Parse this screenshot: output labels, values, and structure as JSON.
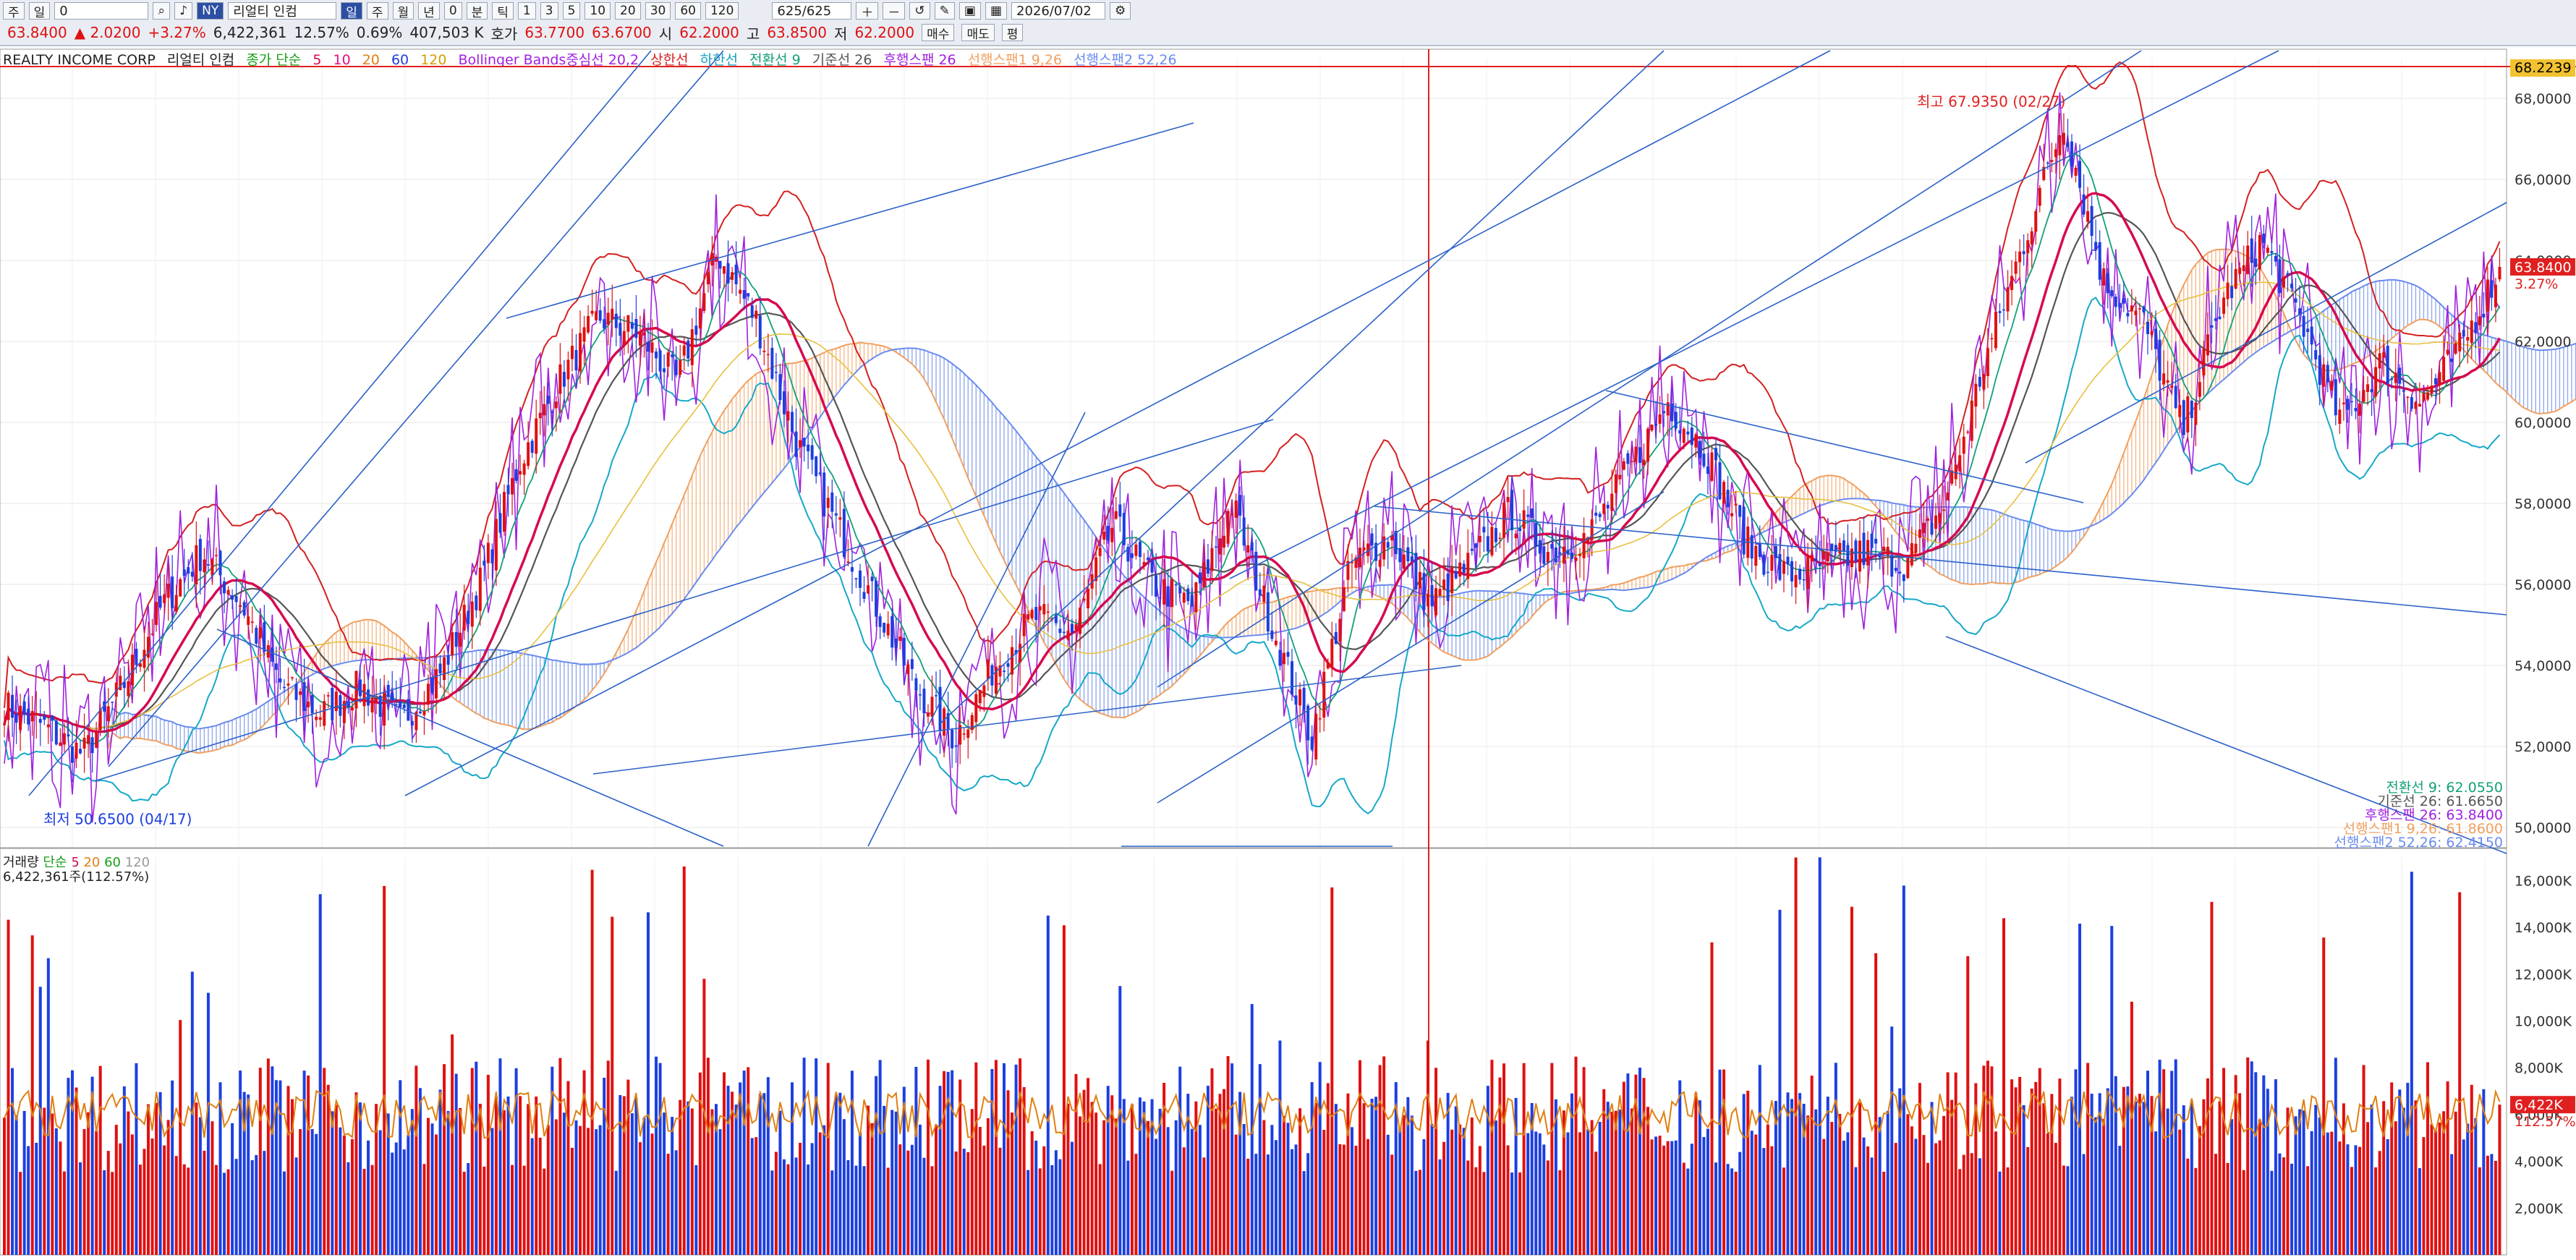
{
  "toolbar": {
    "period_buttons": [
      "주",
      "일",
      "주",
      "월",
      "년",
      "0",
      "분",
      "틱"
    ],
    "code_value": "0",
    "stock_name": "리얼티 인컴",
    "market_badge": "NY",
    "count_value": "625/625",
    "date_value": "2026/07/02",
    "minute_values": [
      "1",
      "3",
      "5",
      "10",
      "20",
      "30",
      "60",
      "120"
    ]
  },
  "quote": {
    "price": "63.8400",
    "change": "▲ 2.0200",
    "change_pct": "+3.27%",
    "volume": "6,422,361",
    "vol_pct": "12.57%",
    "turnover_pct": "0.69%",
    "amount": "407,503 K",
    "ask_label": "호가",
    "ask": "63.7700",
    "bid": "63.6700",
    "open_label": "시",
    "open": "62.2000",
    "high_label": "고",
    "high": "63.8500",
    "low_label": "저",
    "low": "62.2000",
    "buy_label": "매수",
    "sell_label": "매도",
    "eval_label": "평"
  },
  "legend": {
    "title": "REALTY INCOME CORP",
    "name_kr": "리얼티 인컴",
    "ma_label": "종가 단순",
    "ma_periods": [
      "5",
      "10",
      "20",
      "60",
      "120"
    ],
    "bb_label": "Bollinger Bands중심선 20,2",
    "bb_upper": "상한선",
    "bb_lower": "하한선",
    "tenkan": "전환선 9",
    "kijun": "기준선 26",
    "chikou": "후행스팬 26",
    "senkou1": "선행스팬1 9,26",
    "senkou2": "선행스팬2 52,26"
  },
  "annotations": {
    "high_label": "최고 67.9350 (02/27)",
    "low_label": "최저 50.6500 (04/17)"
  },
  "ichimoku_values": [
    "전환선 9: 62.0550",
    "기준선 26: 61.6650",
    "후행스팬 26: 63.8400",
    "선행스팬1 9,26: 61.8600",
    "선행스팬2 52,26: 62.4150"
  ],
  "price_axis": {
    "ticks": [
      "68,0000",
      "66,0000",
      "64,0000",
      "62,0000",
      "60,0000",
      "58,0000",
      "56,0000",
      "54,0000",
      "52,0000",
      "50,0000"
    ],
    "last_price_tag": "63.8400",
    "last_pct_tag": "3.27%",
    "top_tag": "68.2239"
  },
  "volume": {
    "legend_label": "거래량",
    "ma_label": "단순",
    "ma_periods": [
      "5",
      "20",
      "60",
      "120"
    ],
    "current_text": "6,422,361주(112.57%)",
    "axis_ticks": [
      "16,000K",
      "14,000K",
      "12,000K",
      "10,000K",
      "8,000K",
      "6,000K",
      "4,000K",
      "2,000K"
    ],
    "last_tag": "6,422K",
    "last_pct": "112.57%"
  },
  "chart_data": {
    "type": "candlestick",
    "title": "REALTY INCOME CORP",
    "ylim": [
      49.5,
      69.0
    ],
    "price_path": [
      53.0,
      52.5,
      51.8,
      53.5,
      55.5,
      56.8,
      55.5,
      53.5,
      52.8,
      53.5,
      52.6,
      53.8,
      56.0,
      59.0,
      61.0,
      62.6,
      62.2,
      61.0,
      64.2,
      62.5,
      59.5,
      57.5,
      55.5,
      53.5,
      52.2,
      54.0,
      55.2,
      54.8,
      57.5,
      56.0,
      55.5,
      58.0,
      55.0,
      52.2,
      56.5,
      57.2,
      55.5,
      56.5,
      57.8,
      56.8,
      57.2,
      58.8,
      60.5,
      59.2,
      57.0,
      56.2,
      56.5,
      56.8,
      56.5,
      58.0,
      61.5,
      64.5,
      67.5,
      63.5,
      62.5,
      59.8,
      63.0,
      64.5,
      62.5,
      60.0,
      61.5,
      60.5,
      61.8,
      63.84
    ],
    "high": 67.935,
    "high_date": "02/27",
    "low": 50.65,
    "low_date": "04/17",
    "last": 63.84,
    "volume_ylim": [
      0,
      17000000
    ],
    "last_volume": 6422361
  },
  "colors": {
    "up": "#e01010",
    "down": "#1c3fe0",
    "bb": "#d42020",
    "ma5": "#d60a4f",
    "tenkan": "#12a07a",
    "kijun": "#555555",
    "chikou": "#a020e0",
    "trend": "#2b60c8"
  }
}
